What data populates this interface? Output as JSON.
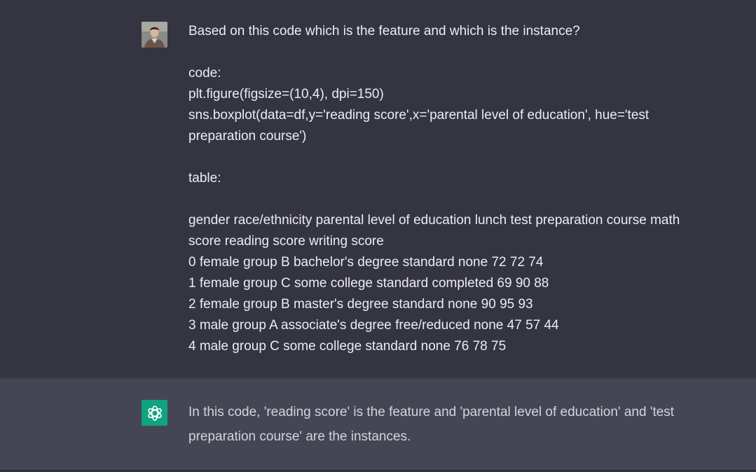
{
  "user_message": {
    "lines": [
      "Based on this code which is the feature and which is the instance?",
      "",
      "code:",
      "plt.figure(figsize=(10,4), dpi=150)",
      "sns.boxplot(data=df,y='reading score',x='parental level of education', hue='test",
      "preparation course')",
      "",
      "table:",
      "",
      "gender race/ethnicity  parental level of education  lunch    test preparation course   math",
      "score    reading score  writing score",
      "0  female group B    bachelor's degree   standard  none     72     72     74",
      "1  female group C    some college   standard  completed   69     90     88",
      "2  female group B    master's degree  standard  none     90     95     93",
      "3  male     group A    associate's degree  free/reduced     none     47     57     44",
      "4  male     group C    some college   standard  none     76     78     75"
    ]
  },
  "assistant_message": {
    "lines": [
      "In this code, 'reading score' is the feature and 'parental level of education' and 'test",
      "preparation course' are the instances."
    ]
  },
  "icons": {
    "user_avatar": "user-avatar-photo",
    "assistant_avatar": "openai-logo-icon"
  },
  "colors": {
    "background": "#343541",
    "assistant_background": "#444654",
    "assistant_avatar": "#10a37f",
    "text": "#ececf1"
  }
}
